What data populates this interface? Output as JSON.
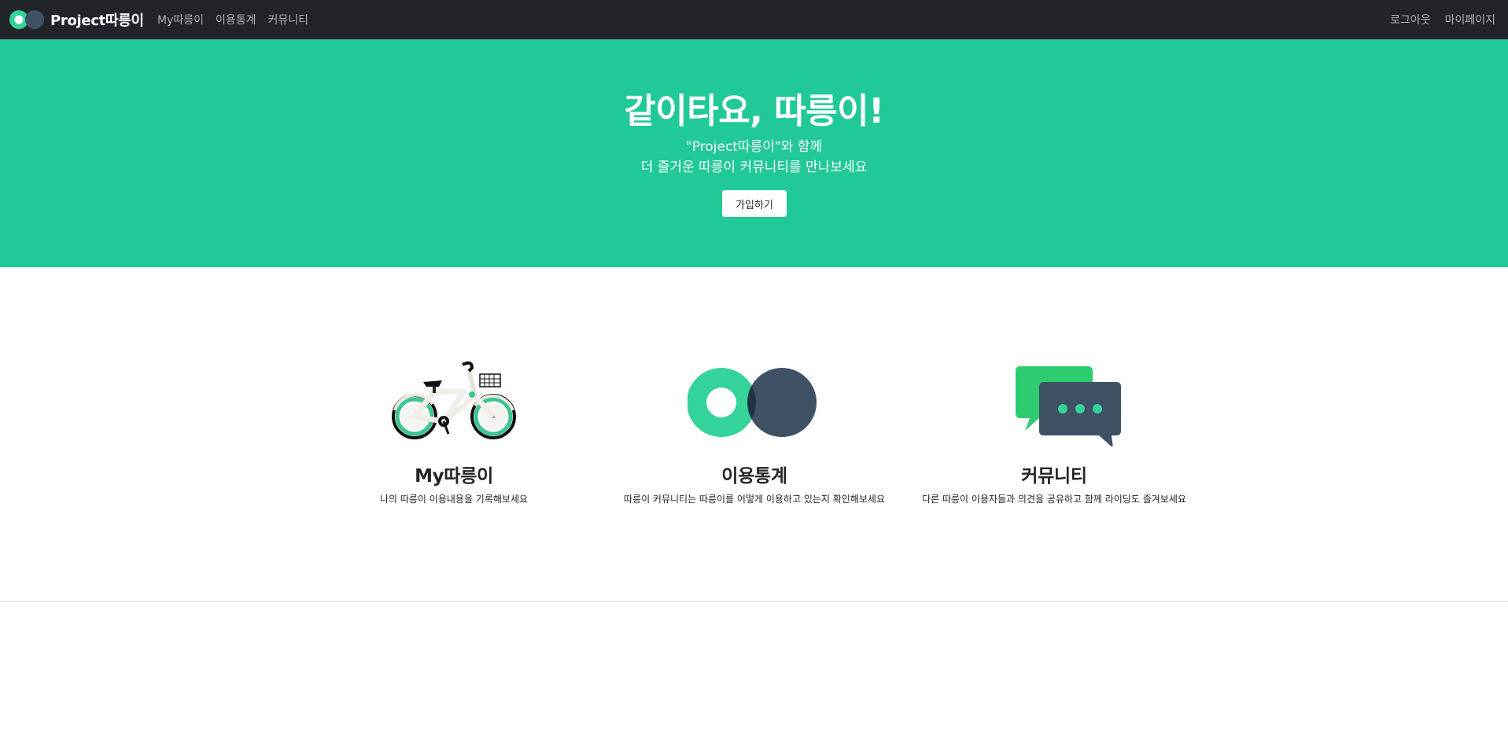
{
  "navbar": {
    "brand": "Project따릉이",
    "left_links": [
      "My따릉이",
      "이용통계",
      "커뮤니티"
    ],
    "right_links": [
      "로그아웃",
      "마이페이지"
    ]
  },
  "hero": {
    "title": "같이타요, 따릉이!",
    "subtitle_line1": "\"Project따릉이\"와 함께",
    "subtitle_line2": "더 즐거운 따릉이 커뮤니티를 만나보세요",
    "join_button": "가입하기"
  },
  "features": [
    {
      "icon": "bicycle-icon",
      "title": "My따릉이",
      "desc": "나의 따릉이 이용내용을 기록해보세요"
    },
    {
      "icon": "statistics-circles-icon",
      "title": "이용통계",
      "desc": "따릉이 커뮤니티는 따릉이를 어떻게 이용하고 있는지 확인해보세요"
    },
    {
      "icon": "chat-bubbles-icon",
      "title": "커뮤니티",
      "desc": "다른 따릉이 이용자들과 의견을 공유하고 함께 라이딩도 즐겨보세요"
    }
  ],
  "colors": {
    "navbar_bg": "#212529",
    "hero_bg": "#20c997",
    "brand_green": "#34d399",
    "brand_slate": "#3f5165"
  }
}
